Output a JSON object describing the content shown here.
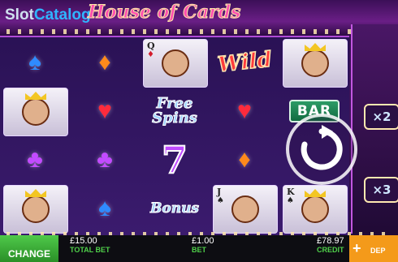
{
  "watermark": {
    "part1": "Slot",
    "part2": "Catalog"
  },
  "game": {
    "title": "House of Cards"
  },
  "symbols": {
    "wild": "Wild",
    "free_spins_1": "Free",
    "free_spins_2": "Spins",
    "bonus": "Bonus",
    "bar": "BAR",
    "seven": "7",
    "queen_rank": "Q",
    "jack_rank": "J",
    "king_rank": "K",
    "spade": "♠",
    "diamond": "♦",
    "heart": "♥",
    "club": "♣"
  },
  "side_multipliers": [
    "×2",
    "×3"
  ],
  "bottom_bar": {
    "change_label": "CHANGE",
    "total_bet_value": "£15.00",
    "total_bet_label": "TOTAL BET",
    "bet_value": "£1.00",
    "bet_label": "BET",
    "credit_value": "£78.97",
    "credit_label": "CREDIT",
    "deposit_label": "DEP"
  },
  "colors": {
    "accent_green": "#4fd04a",
    "deposit_orange": "#f49a1a",
    "frame_purple": "#6a1e86"
  }
}
